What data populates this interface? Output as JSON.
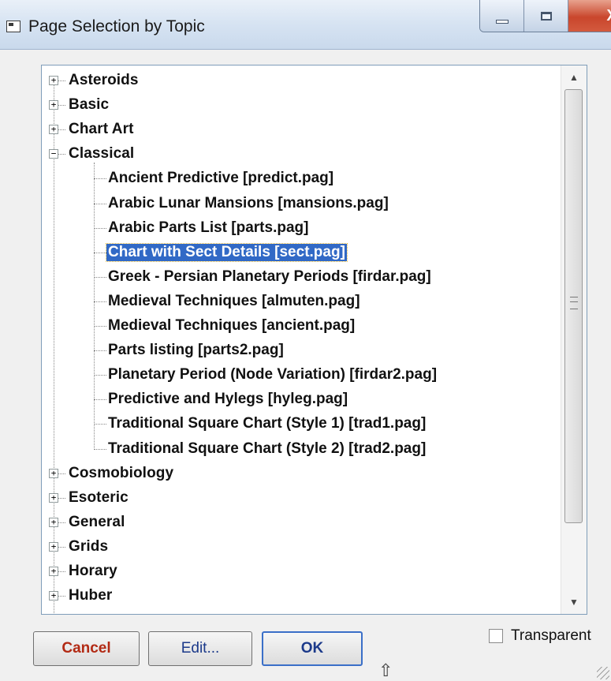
{
  "window": {
    "title": "Page Selection by Topic",
    "controls": {
      "minimize_icon": "minimize-icon",
      "maximize_icon": "maximize-icon",
      "close_glyph": "X"
    }
  },
  "tree": {
    "items": [
      {
        "label": "Asteroids",
        "expander": "+",
        "expanded": false
      },
      {
        "label": "Basic",
        "expander": "+",
        "expanded": false
      },
      {
        "label": "Chart Art",
        "expander": "+",
        "expanded": false
      },
      {
        "label": "Classical",
        "expander": "−",
        "expanded": true,
        "children": [
          "Ancient Predictive [predict.pag]",
          "Arabic Lunar Mansions [mansions.pag]",
          "Arabic Parts List [parts.pag]",
          "Chart with Sect Details [sect.pag]",
          "Greek - Persian Planetary Periods [firdar.pag]",
          "Medieval Techniques [almuten.pag]",
          "Medieval Techniques [ancient.pag]",
          "Parts listing [parts2.pag]",
          "Planetary Period (Node Variation) [firdar2.pag]",
          "Predictive and Hylegs [hyleg.pag]",
          "Traditional Square Chart (Style 1) [trad1.pag]",
          "Traditional Square Chart (Style 2) [trad2.pag]"
        ],
        "selected_child": "Chart with Sect Details [sect.pag]"
      },
      {
        "label": "Cosmobiology",
        "expander": "+",
        "expanded": false
      },
      {
        "label": "Esoteric",
        "expander": "+",
        "expanded": false
      },
      {
        "label": "General",
        "expander": "+",
        "expanded": false
      },
      {
        "label": "Grids",
        "expander": "+",
        "expanded": false
      },
      {
        "label": "Horary",
        "expander": "+",
        "expanded": false
      },
      {
        "label": "Huber",
        "expander": "+",
        "expanded": false
      }
    ]
  },
  "scrollbar": {
    "up_arrow": "▲",
    "down_arrow": "▼"
  },
  "buttons": {
    "cancel": "Cancel",
    "edit": "Edit...",
    "ok": "OK"
  },
  "checkbox": {
    "label": "Transparent",
    "checked": false
  },
  "colors": {
    "selection": "#3169c6",
    "cancel_text": "#b22a14",
    "close_button": "#c9462c"
  }
}
